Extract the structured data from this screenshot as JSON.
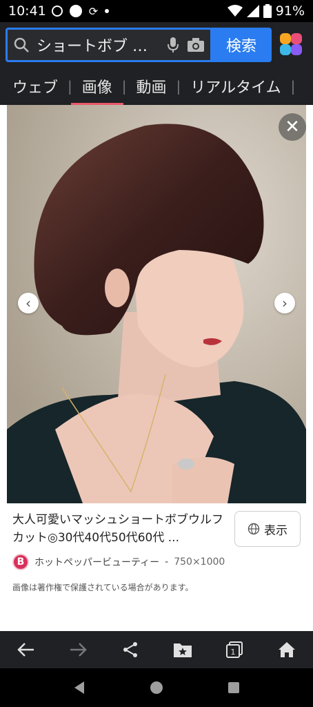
{
  "status_bar": {
    "time": "10:41",
    "battery": "91%"
  },
  "search": {
    "query": "ショートボブ …",
    "button_label": "検索"
  },
  "tabs": [
    {
      "label": "ウェブ"
    },
    {
      "label": "画像"
    },
    {
      "label": "動画"
    },
    {
      "label": "リアルタイム"
    }
  ],
  "result": {
    "caption": "大人可愛いマッシュショートボブウルフカット◎30代40代50代60代 ...",
    "show_label": "表示",
    "source_name": "ホットペッパービューティー",
    "source_logo_letter": "B",
    "dimensions": "750×1000",
    "separator": "-",
    "copyright_notice": "画像は著作権で保護されている場合があります。"
  },
  "colors": {
    "accent": "#2a7cf0",
    "tab_indicator": "#e9586a",
    "header_bg": "#202124"
  }
}
